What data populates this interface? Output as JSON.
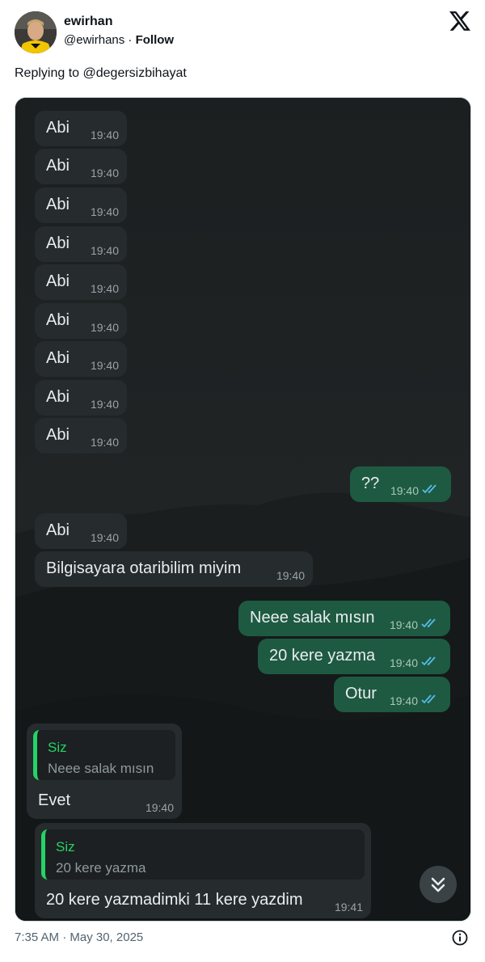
{
  "tweet": {
    "author_name": "ewirhan",
    "handle": "@ewirhans",
    "separator": " · ",
    "follow_label": "Follow",
    "replying_prefix": "Replying to ",
    "replying_to": "@degersizbihayat",
    "timestamp": "7:35 AM · May 30, 2025"
  },
  "chat": {
    "messages": [
      {
        "dir": "in",
        "text": "Abi",
        "time": "19:40"
      },
      {
        "dir": "in",
        "text": "Abi",
        "time": "19:40"
      },
      {
        "dir": "in",
        "text": "Abi",
        "time": "19:40"
      },
      {
        "dir": "in",
        "text": "Abi",
        "time": "19:40"
      },
      {
        "dir": "in",
        "text": "Abi",
        "time": "19:40"
      },
      {
        "dir": "in",
        "text": "Abi",
        "time": "19:40"
      },
      {
        "dir": "in",
        "text": "Abi",
        "time": "19:40"
      },
      {
        "dir": "in",
        "text": "Abi",
        "time": "19:40"
      },
      {
        "dir": "in",
        "text": "Abi",
        "time": "19:40"
      },
      {
        "dir": "out",
        "text": "??",
        "time": "19:40",
        "read": true
      },
      {
        "dir": "in",
        "text": "Abi",
        "time": "19:40"
      },
      {
        "dir": "in",
        "text": "Bilgisayara otaribilim miyim",
        "time": "19:40"
      },
      {
        "dir": "out",
        "text": "Neee salak mısın",
        "time": "19:40",
        "read": true
      },
      {
        "dir": "out",
        "text": "20 kere yazma",
        "time": "19:40",
        "read": true
      },
      {
        "dir": "out",
        "text": "Otur",
        "time": "19:40",
        "read": true
      },
      {
        "dir": "in",
        "text": "Evet",
        "time": "19:40",
        "quote_author": "Siz",
        "quote_text": "Neee salak mısın"
      },
      {
        "dir": "in",
        "text": "20 kere yazmadimki 11 kere yazdim",
        "time": "19:41",
        "quote_author": "Siz",
        "quote_text": "20 kere yazma"
      }
    ],
    "colors": {
      "background": "#1f2223",
      "incoming_bubble": "#262b2d",
      "outgoing_bubble": "#1e5a42",
      "read_ticks": "#53bdeb",
      "quote_accent": "#25d366"
    }
  }
}
